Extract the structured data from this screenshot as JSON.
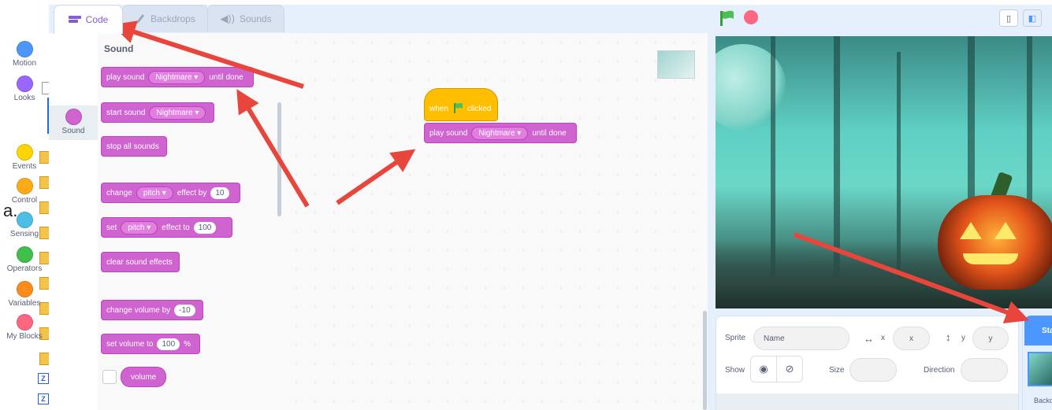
{
  "doc": {
    "list_letter": "a.",
    "z_icons": [
      "Z",
      "Z"
    ]
  },
  "tabs": [
    {
      "label": "Code",
      "icon": "code-icon",
      "active": true
    },
    {
      "label": "Backdrops",
      "icon": "paintbrush-icon",
      "active": false
    },
    {
      "label": "Sounds",
      "icon": "speaker-icon",
      "active": false
    }
  ],
  "categories": [
    {
      "label": "Motion",
      "color": "#4c97ff"
    },
    {
      "label": "Looks",
      "color": "#9966ff"
    },
    {
      "label": "Sound",
      "color": "#cf63cf",
      "selected": true
    },
    {
      "label": "Events",
      "color": "#ffd500"
    },
    {
      "label": "Control",
      "color": "#ffab19"
    },
    {
      "label": "Sensing",
      "color": "#4cbfe6"
    },
    {
      "label": "Operators",
      "color": "#40bf4a"
    },
    {
      "label": "Variables",
      "color": "#ff8c1a"
    },
    {
      "label": "My Blocks",
      "color": "#ff6680"
    }
  ],
  "palette": {
    "title": "Sound",
    "play_sound": {
      "prefix": "play sound",
      "sound": "Nightmare",
      "suffix": "until done"
    },
    "start_sound": {
      "prefix": "start sound",
      "sound": "Nightmare"
    },
    "stop_all": "stop all sounds",
    "change_effect": {
      "prefix": "change",
      "effect": "pitch",
      "mid": "effect by",
      "value": "10"
    },
    "set_effect": {
      "prefix": "set",
      "effect": "pitch",
      "mid": "effect to",
      "value": "100"
    },
    "clear_effects": "clear sound effects",
    "change_volume": {
      "prefix": "change volume by",
      "value": "-10"
    },
    "set_volume": {
      "prefix": "set volume to",
      "value": "100",
      "suffix": "%"
    },
    "volume_reporter": "volume"
  },
  "script": {
    "hat": {
      "prefix": "when",
      "suffix": "clicked"
    },
    "play_sound": {
      "prefix": "play sound",
      "sound": "Nightmare",
      "suffix": "until done"
    }
  },
  "sprite_info": {
    "sprite_label": "Sprite",
    "name_placeholder": "Name",
    "x_label": "x",
    "x_placeholder": "x",
    "y_label": "y",
    "y_placeholder": "y",
    "show_label": "Show",
    "size_label": "Size",
    "direction_label": "Direction"
  },
  "stage_target": {
    "header": "Stage",
    "backdrop_label": "Backdrops"
  },
  "colors": {
    "sound_block": "#cf63cf",
    "events_block": "#ffbf00",
    "arrow": "#e8453c",
    "accent": "#855cd6"
  }
}
